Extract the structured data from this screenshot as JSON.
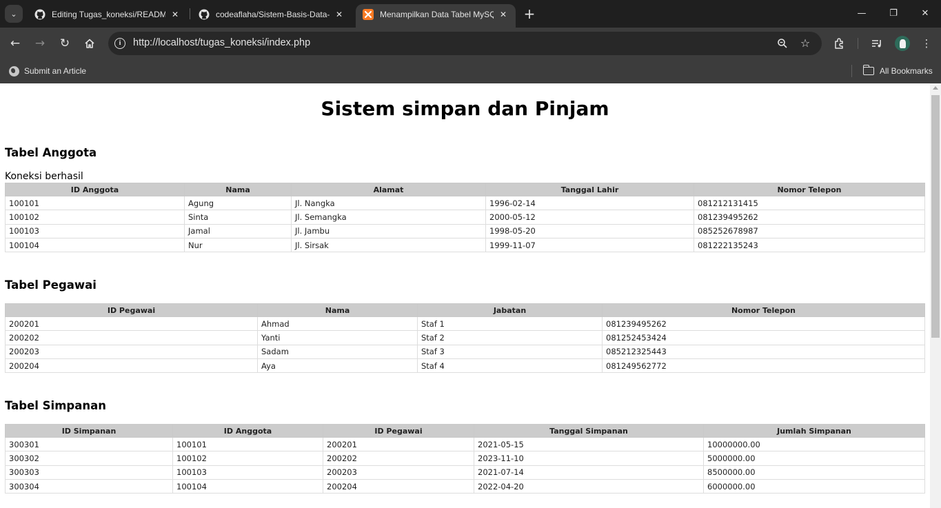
{
  "browser": {
    "tabs": [
      {
        "title": "Editing Tugas_koneksi/README",
        "icon": "github-icon"
      },
      {
        "title": "codeaflaha/Sistem-Basis-Data-",
        "icon": "github-icon"
      },
      {
        "title": "Menampilkan Data Tabel MySQL",
        "icon": "xampp-icon"
      }
    ],
    "url": "http://localhost/tugas_koneksi/index.php",
    "bookmarks": {
      "item": "Submit an Article",
      "all": "All Bookmarks"
    }
  },
  "page": {
    "title": "Sistem simpan dan Pinjam",
    "connection_message": "Koneksi berhasil",
    "anggota": {
      "heading": "Tabel Anggota",
      "headers": [
        "ID Anggota",
        "Nama",
        "Alamat",
        "Tanggal Lahir",
        "Nomor Telepon"
      ],
      "rows": [
        [
          "100101",
          "Agung",
          "Jl. Nangka",
          "1996-02-14",
          "081212131415"
        ],
        [
          "100102",
          "Sinta",
          "Jl. Semangka",
          "2000-05-12",
          "081239495262"
        ],
        [
          "100103",
          "Jamal",
          "Jl. Jambu",
          "1998-05-20",
          "085252678987"
        ],
        [
          "100104",
          "Nur",
          "Jl. Sirsak",
          "1999-11-07",
          "081222135243"
        ]
      ]
    },
    "pegawai": {
      "heading": "Tabel Pegawai",
      "headers": [
        "ID Pegawai",
        "Nama",
        "Jabatan",
        "Nomor Telepon"
      ],
      "rows": [
        [
          "200201",
          "Ahmad",
          "Staf 1",
          "081239495262"
        ],
        [
          "200202",
          "Yanti",
          "Staf 2",
          "081252453424"
        ],
        [
          "200203",
          "Sadam",
          "Staf 3",
          "085212325443"
        ],
        [
          "200204",
          "Aya",
          "Staf 4",
          "081249562772"
        ]
      ]
    },
    "simpanan": {
      "heading": "Tabel Simpanan",
      "headers": [
        "ID Simpanan",
        "ID Anggota",
        "ID Pegawai",
        "Tanggal Simpanan",
        "Jumlah Simpanan"
      ],
      "rows": [
        [
          "300301",
          "100101",
          "200201",
          "2021-05-15",
          "10000000.00"
        ],
        [
          "300302",
          "100102",
          "200202",
          "2023-11-10",
          "5000000.00"
        ],
        [
          "300303",
          "100103",
          "200203",
          "2021-07-14",
          "8500000.00"
        ],
        [
          "300304",
          "100104",
          "200204",
          "2022-04-20",
          "6000000.00"
        ]
      ]
    }
  }
}
